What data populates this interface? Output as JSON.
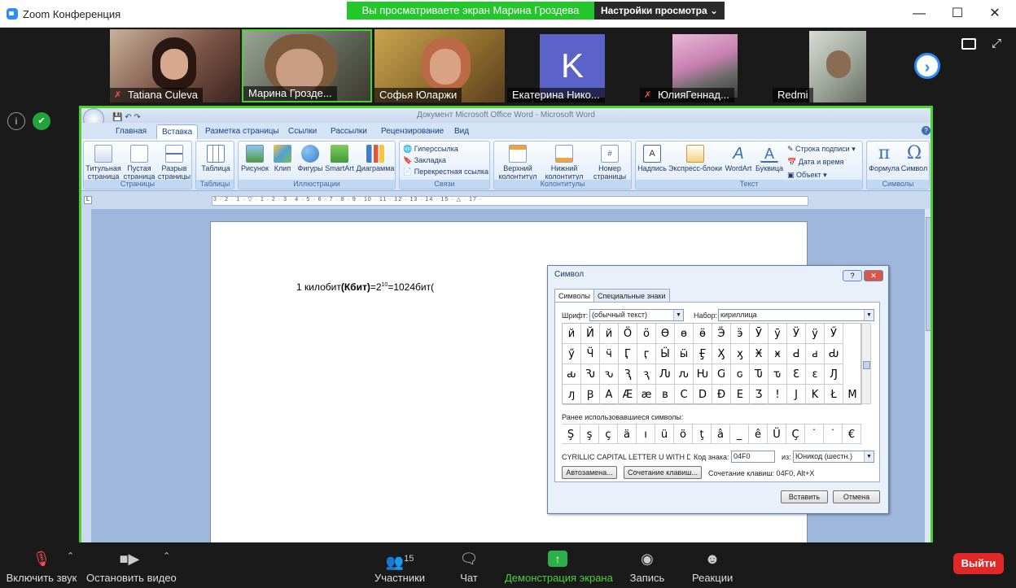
{
  "zoom": {
    "window_title": "Zoom Конференция",
    "viewing_banner": "Вы просматриваете экран Марина Гроздева",
    "view_options": "Настройки просмотра ⌄",
    "participants": [
      {
        "name": "Tatiana Culeva",
        "muted": true
      },
      {
        "name": "Марина Грозде...",
        "muted": false
      },
      {
        "name": "Софья Юларжи",
        "muted": false
      },
      {
        "name": "Екатерина Нико...",
        "muted": false,
        "avatar_letter": "K"
      },
      {
        "name": "ЮлияГеннад...",
        "muted": true
      },
      {
        "name": "Redmi",
        "muted": false
      }
    ],
    "controls": {
      "mute": "Включить звук",
      "video": "Остановить видео",
      "participants": "Участники",
      "participants_count": "15",
      "chat": "Чат",
      "share": "Демонстрация экрана",
      "record": "Запись",
      "reactions": "Реакции",
      "leave": "Выйти"
    }
  },
  "word": {
    "title": "Документ Microsoft Office Word - Microsoft Word",
    "tabs": [
      "Главная",
      "Вставка",
      "Разметка страницы",
      "Ссылки",
      "Рассылки",
      "Рецензирование",
      "Вид"
    ],
    "active_tab": "Вставка",
    "groups": {
      "pages": {
        "label": "Страницы",
        "buttons": [
          "Титульная страница",
          "Пустая страница",
          "Разрыв страницы"
        ]
      },
      "tables": {
        "label": "Таблицы",
        "buttons": [
          "Таблица"
        ]
      },
      "illustrations": {
        "label": "Иллюстрации",
        "buttons": [
          "Рисунок",
          "Клип",
          "Фигуры",
          "SmartArt",
          "Диаграмма"
        ]
      },
      "links": {
        "label": "Связи",
        "items": [
          "Гиперссылка",
          "Закладка",
          "Перекрестная ссылка"
        ]
      },
      "headers": {
        "label": "Колонтитулы",
        "buttons": [
          "Верхний колонтитул",
          "Нижний колонтитул",
          "Номер страницы"
        ]
      },
      "text": {
        "label": "Текст",
        "buttons": [
          "Надпись",
          "Экспресс-блоки",
          "WordArt",
          "Буквица"
        ],
        "items": [
          "Строка подписи",
          "Дата и время",
          "Объект"
        ]
      },
      "symbols": {
        "label": "Символы",
        "buttons": [
          "Формула",
          "Символ"
        ]
      }
    },
    "ruler": "3 · 2 · 1 · ▽ · 1 · 2 · 3 · 4 · 5 · 6 · 7 · 8 · 9 · 10 · 11 · 12 · 13 · 14 · 15 · △ · 17 ·",
    "document_text": {
      "prefix": "1 килобит",
      "bold": "(Кбит)",
      "middle": "=2",
      "superscript": "10",
      "suffix": "=1024бит("
    }
  },
  "symbol_dialog": {
    "title": "Символ",
    "tabs": [
      "Символы",
      "Специальные знаки"
    ],
    "font_label": "Шрифт:",
    "font_value": "(обычный текст)",
    "subset_label": "Набор:",
    "subset_value": "кириллица",
    "grid": [
      [
        "й",
        "Й",
        "й",
        "Ӧ",
        "ӧ",
        "Ө",
        "ө",
        "ӫ",
        "Ӭ",
        "ӭ",
        "Ӯ",
        "ӯ",
        "Ӱ",
        "ӱ",
        "Ӳ"
      ],
      [
        "ӳ",
        "Ӵ",
        "ӵ",
        "Ӷ",
        "ӷ",
        "Ӹ",
        "ӹ",
        "Ӻ",
        "Ӽ",
        "ӽ",
        "Ӿ",
        "ӿ",
        "Ԁ",
        "ԁ",
        "Ԃ"
      ],
      [
        "ԃ",
        "Ԅ",
        "ԅ",
        "Ԇ",
        "ԇ",
        "Ԉ",
        "ԉ",
        "Ԋ",
        "Ԍ",
        "ԍ",
        "Ԏ",
        "ԏ",
        "Ɛ",
        "ɛ",
        "Ԓ"
      ],
      [
        "ԓ",
        "Ꞵ",
        "А",
        "Æ",
        "æ",
        "в",
        "С",
        "D",
        "Đ",
        "Е",
        "Ʒ",
        "!",
        "J",
        "K",
        "Ł",
        "М"
      ]
    ],
    "recent_label": "Ранее использовавшиеся символы:",
    "recent": [
      "Ş",
      "ş",
      "ç",
      "ä",
      "ı",
      "ü",
      "ö",
      "ţ",
      "â",
      "_",
      "ê",
      "Ü",
      "Ç",
      "˙",
      "˙",
      "€"
    ],
    "char_name": "CYRILLIC CAPITAL LETTER U WITH DIA...",
    "code_label": "Код знака:",
    "code_value": "04F0",
    "from_label": "из:",
    "from_value": "Юникод (шестн.)",
    "autocorrect": "Автозамена...",
    "shortcut_key": "Сочетание клавиш...",
    "shortcut_text": "Сочетание клавиш: 04F0, Alt+X",
    "insert": "Вставить",
    "cancel": "Отмена"
  }
}
